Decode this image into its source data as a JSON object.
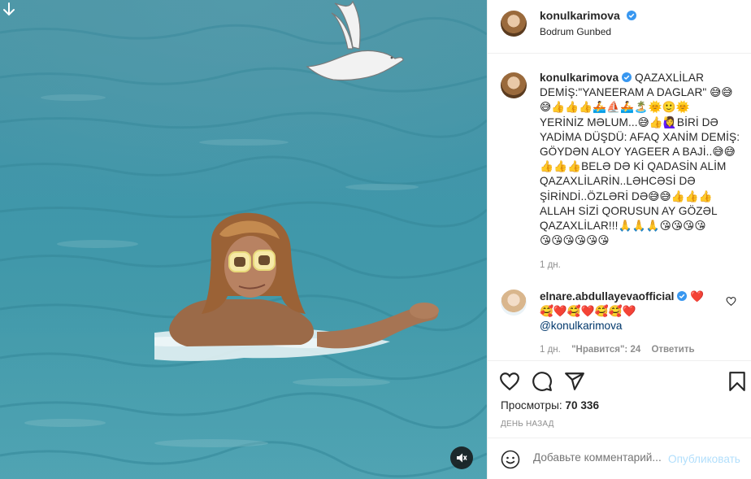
{
  "header": {
    "username": "konulkarimova",
    "location": "Bodrum Gunbed"
  },
  "caption": {
    "username": "konulkarimova",
    "lines": [
      "QAZAXLİLAR",
      "DEMİŞ:\"YANEERAM A DAGLAR\" 😅😅",
      "😅👍👍👍🚣⛵🚣🏝️🌞🙂🌞",
      "YERİNİZ MƏLUM...😅👍🙋‍♀️BİRİ DƏ",
      "YADİMA DÜŞDÜ: AFAQ XANİM DEMİŞ:",
      "GÖYDƏN ALOY YAGEER A BAJİ..😅😅",
      "👍👍👍BELƏ DƏ Kİ QADASİN ALİM",
      "QAZAXLİLARİN..LƏHCƏSİ DƏ",
      "ŞİRİNDİ..ÖZLƏRİ DƏ😅😅👍👍👍",
      "ALLAH SİZİ QORUSUN AY GÖZƏL",
      "QAZAXLİLAR!!!🙏🙏🙏😘😘😘😘",
      "😘😘😘😘😘😘"
    ],
    "time": "1 дн."
  },
  "comment": {
    "username": "elnare.abdullayeva​official",
    "emoji_line1": "❤️",
    "emoji_line2": "🥰❤️🥰❤️🥰🥰❤️",
    "mention": "@konulkarimova",
    "time": "1 дн.",
    "likes": "\"Нравится\": 24",
    "reply": "Ответить"
  },
  "stats": {
    "views_label": "Просмотры:",
    "views_value": "70 336",
    "posted": "ДЕНЬ НАЗАД"
  },
  "add_comment": {
    "placeholder": "Добавьте комментарий...",
    "publish": "Опубликовать"
  },
  "colors": {
    "verified": "#3897f0",
    "link": "#00376b",
    "muted": "#8e8e8e",
    "heart": "#ed4956",
    "publish_disabled": "#b2dffc"
  },
  "icons": {
    "media_corner": "download-arrow-icon",
    "mute": "speaker-muted-icon",
    "like": "heart-outline-icon",
    "comment": "comment-bubble-icon",
    "share": "paper-plane-icon",
    "save": "bookmark-icon",
    "emoji": "smiley-icon"
  }
}
